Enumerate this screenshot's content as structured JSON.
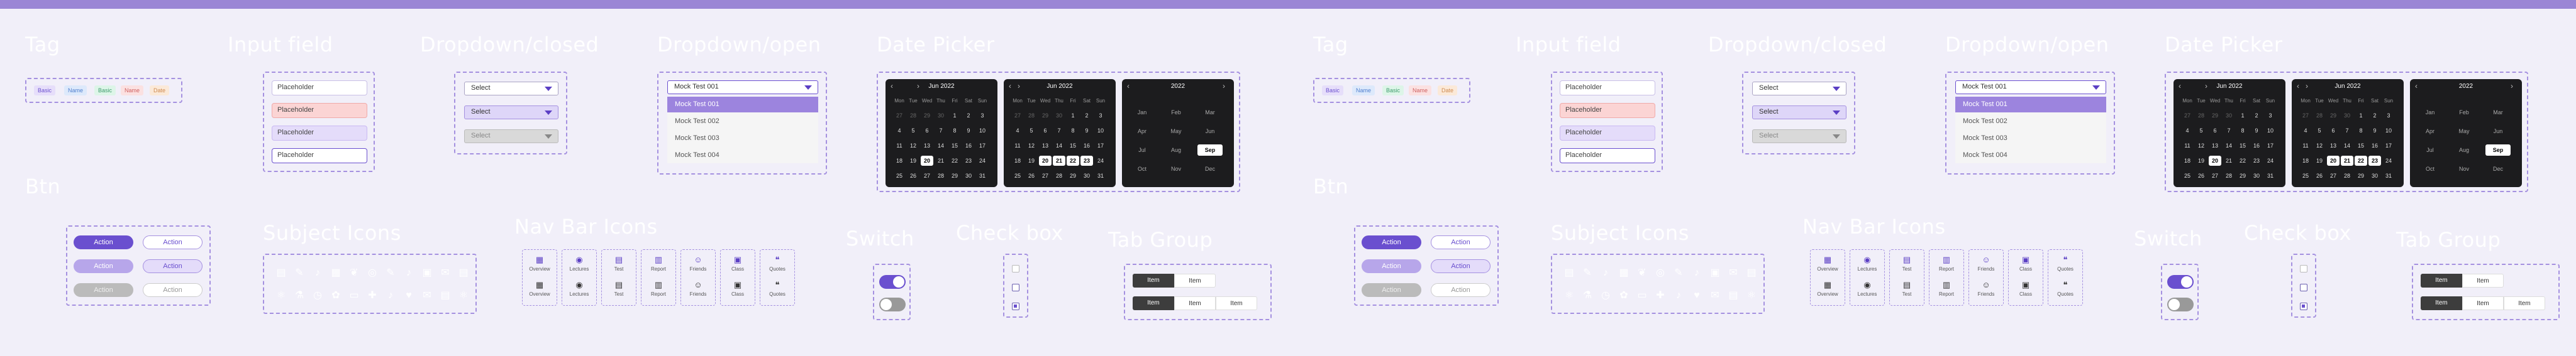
{
  "sections": {
    "tag": "Tag",
    "input_field": "Input field",
    "dropdown_closed": "Dropdown/closed",
    "dropdown_open": "Dropdown/open",
    "date_picker": "Date Picker",
    "btn": "Btn",
    "subject_icons": "Subject Icons",
    "nav_bar_icons": "Nav Bar Icons",
    "switch": "Switch",
    "check_box": "Check box",
    "tab_group": "Tab Group"
  },
  "tags": [
    {
      "label": "Basic",
      "bg": "#e6defa",
      "fg": "#6a4fcf"
    },
    {
      "label": "Name",
      "bg": "#dde9fb",
      "fg": "#4f7fcf"
    },
    {
      "label": "Basic",
      "bg": "#ddf5e8",
      "fg": "#3c9b6b"
    },
    {
      "label": "Name",
      "bg": "#fbe1e1",
      "fg": "#cf5f5f"
    },
    {
      "label": "Date",
      "bg": "#fbe9d8",
      "fg": "#cf8a4f"
    }
  ],
  "inputs": [
    {
      "placeholder": "Placeholder",
      "state": "default"
    },
    {
      "placeholder": "Placeholder",
      "state": "error"
    },
    {
      "placeholder": "Placeholder",
      "state": "focus"
    },
    {
      "placeholder": "Placeholder",
      "state": "active"
    }
  ],
  "dropdown_closed": [
    "Select",
    "Select",
    "Select"
  ],
  "dropdown_open": {
    "selected": "Mock Test 001",
    "options": [
      "Mock Test 001",
      "Mock Test 002",
      "Mock Test 003",
      "Mock Test 004"
    ]
  },
  "date_picker": {
    "day_header": "Jun 2022",
    "year_header": "2022",
    "weekdays": [
      "Mon",
      "Tue",
      "Wed",
      "Thu",
      "Fri",
      "Sat",
      "Sun"
    ],
    "weeks": [
      [
        "27",
        "28",
        "29",
        "30",
        "1",
        "2",
        "3"
      ],
      [
        "4",
        "5",
        "6",
        "7",
        "8",
        "9",
        "10"
      ],
      [
        "11",
        "12",
        "13",
        "14",
        "15",
        "16",
        "17"
      ],
      [
        "18",
        "19",
        "20",
        "21",
        "22",
        "23",
        "24"
      ],
      [
        "25",
        "26",
        "27",
        "28",
        "29",
        "30",
        "31"
      ]
    ],
    "months": [
      "Jan",
      "Feb",
      "Mar",
      "Apr",
      "May",
      "Jun",
      "Jul",
      "Aug",
      "Sep",
      "Oct",
      "Nov",
      "Dec"
    ],
    "selected_day": "20",
    "range_days": [
      "20",
      "21",
      "22",
      "23"
    ],
    "selected_month": "Sep"
  },
  "buttons": {
    "rows": [
      {
        "label": "Action",
        "alt": "Action"
      },
      {
        "label": "Action",
        "alt": "Action"
      },
      {
        "label": "Action",
        "alt": "Action"
      }
    ]
  },
  "subject_icons": [
    "book-icon",
    "paint-icon",
    "music-icon",
    "grid-icon",
    "leaf-icon",
    "globe-icon",
    "paint-icon",
    "music-icon",
    "calc-icon",
    "chat-icon",
    "book-icon",
    "atom-icon",
    "flask-icon",
    "clock-icon",
    "palette-icon",
    "ruler-icon",
    "plus-icon",
    "music-icon",
    "heart-icon",
    "chat-icon",
    "book-icon",
    "atom-icon"
  ],
  "nav_bar": [
    {
      "top": "Overview",
      "bottom": "Overview"
    },
    {
      "top": "Lectures",
      "bottom": "Lectures"
    },
    {
      "top": "Test",
      "bottom": "Test"
    },
    {
      "top": "Report",
      "bottom": "Report"
    },
    {
      "top": "Friends",
      "bottom": "Friends"
    },
    {
      "top": "Class",
      "bottom": "Class"
    },
    {
      "top": "Quotes",
      "bottom": "Quotes"
    }
  ],
  "tab_group": {
    "row1": [
      "Item",
      "Item"
    ],
    "row2": [
      "Item",
      "Item",
      "Item"
    ]
  },
  "colors": {
    "accent": "#6a4fcf",
    "accent_light": "#b7a6ea",
    "topbar": "#9b86d5",
    "background": "#f1eff9"
  }
}
